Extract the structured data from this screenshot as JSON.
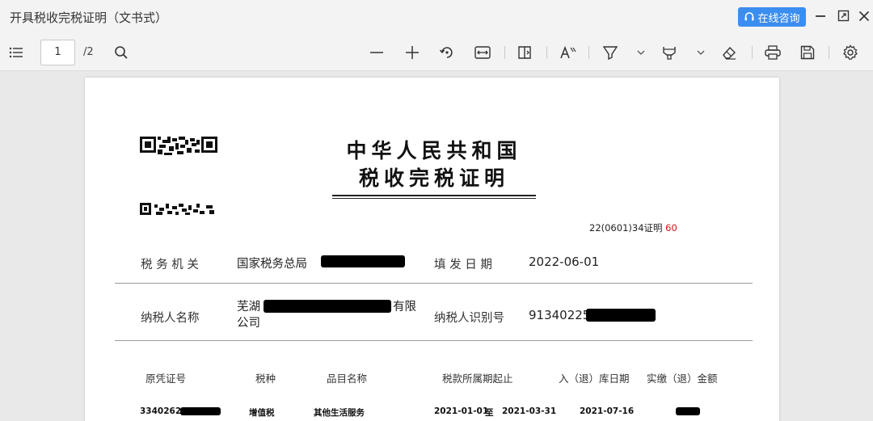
{
  "window": {
    "title": "开具税收完税证明（文书式）",
    "consult_label": "在线咨询"
  },
  "toolbar": {
    "page_current": "1",
    "page_total": "/2"
  },
  "document": {
    "title_line1": "中华人民共和国",
    "title_line2": "税收完税证明",
    "cert_number": "22(0601)34证明",
    "cert_number_red": "60",
    "tax_authority_label": "税 务 机 关",
    "tax_authority_value": "国家税务总局",
    "fill_date_label": "填 发 日 期",
    "fill_date_value": "2022-06-01",
    "taxpayer_name_label": "纳税人名称",
    "taxpayer_name_line1_a": "芜湖",
    "taxpayer_name_line1_b": "有限",
    "taxpayer_name_line2": "公司",
    "taxpayer_id_label": "纳税人识别号",
    "taxpayer_id_value": "91340225",
    "table": {
      "headers": [
        "原凭证号",
        "税种",
        "品目名称",
        "税款所属期起止",
        "入（退）库日期",
        "实缴（退）金额"
      ],
      "rows": [
        {
          "voucher": "33402621",
          "tax_type": "增值税",
          "item_name": "其他生活服务",
          "period_start": "2021-01-01",
          "period_to": "至",
          "period_end": "2021-03-31",
          "storage_date": "2021-07-16"
        }
      ]
    }
  }
}
